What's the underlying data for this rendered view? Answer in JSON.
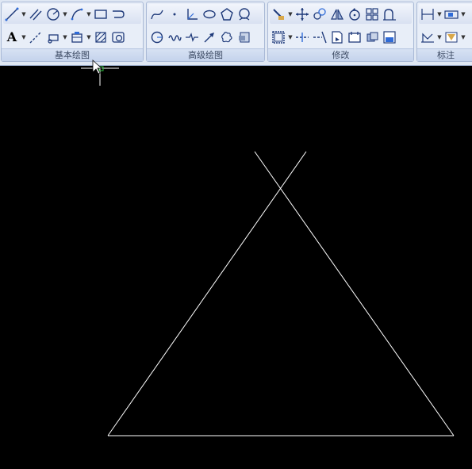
{
  "ribbon": {
    "panels": [
      {
        "title": "基本绘图"
      },
      {
        "title": "高级绘图"
      },
      {
        "title": "修改"
      },
      {
        "title": "标注"
      }
    ],
    "text_tool_glyph": "A"
  },
  "colors": {
    "ribbon_bg": "#dfe7f3",
    "canvas_bg": "#000000",
    "drawing_line": "#ffffff",
    "icon_stroke": "#1f3a7a",
    "icon_accent": "#2f6bd8"
  }
}
